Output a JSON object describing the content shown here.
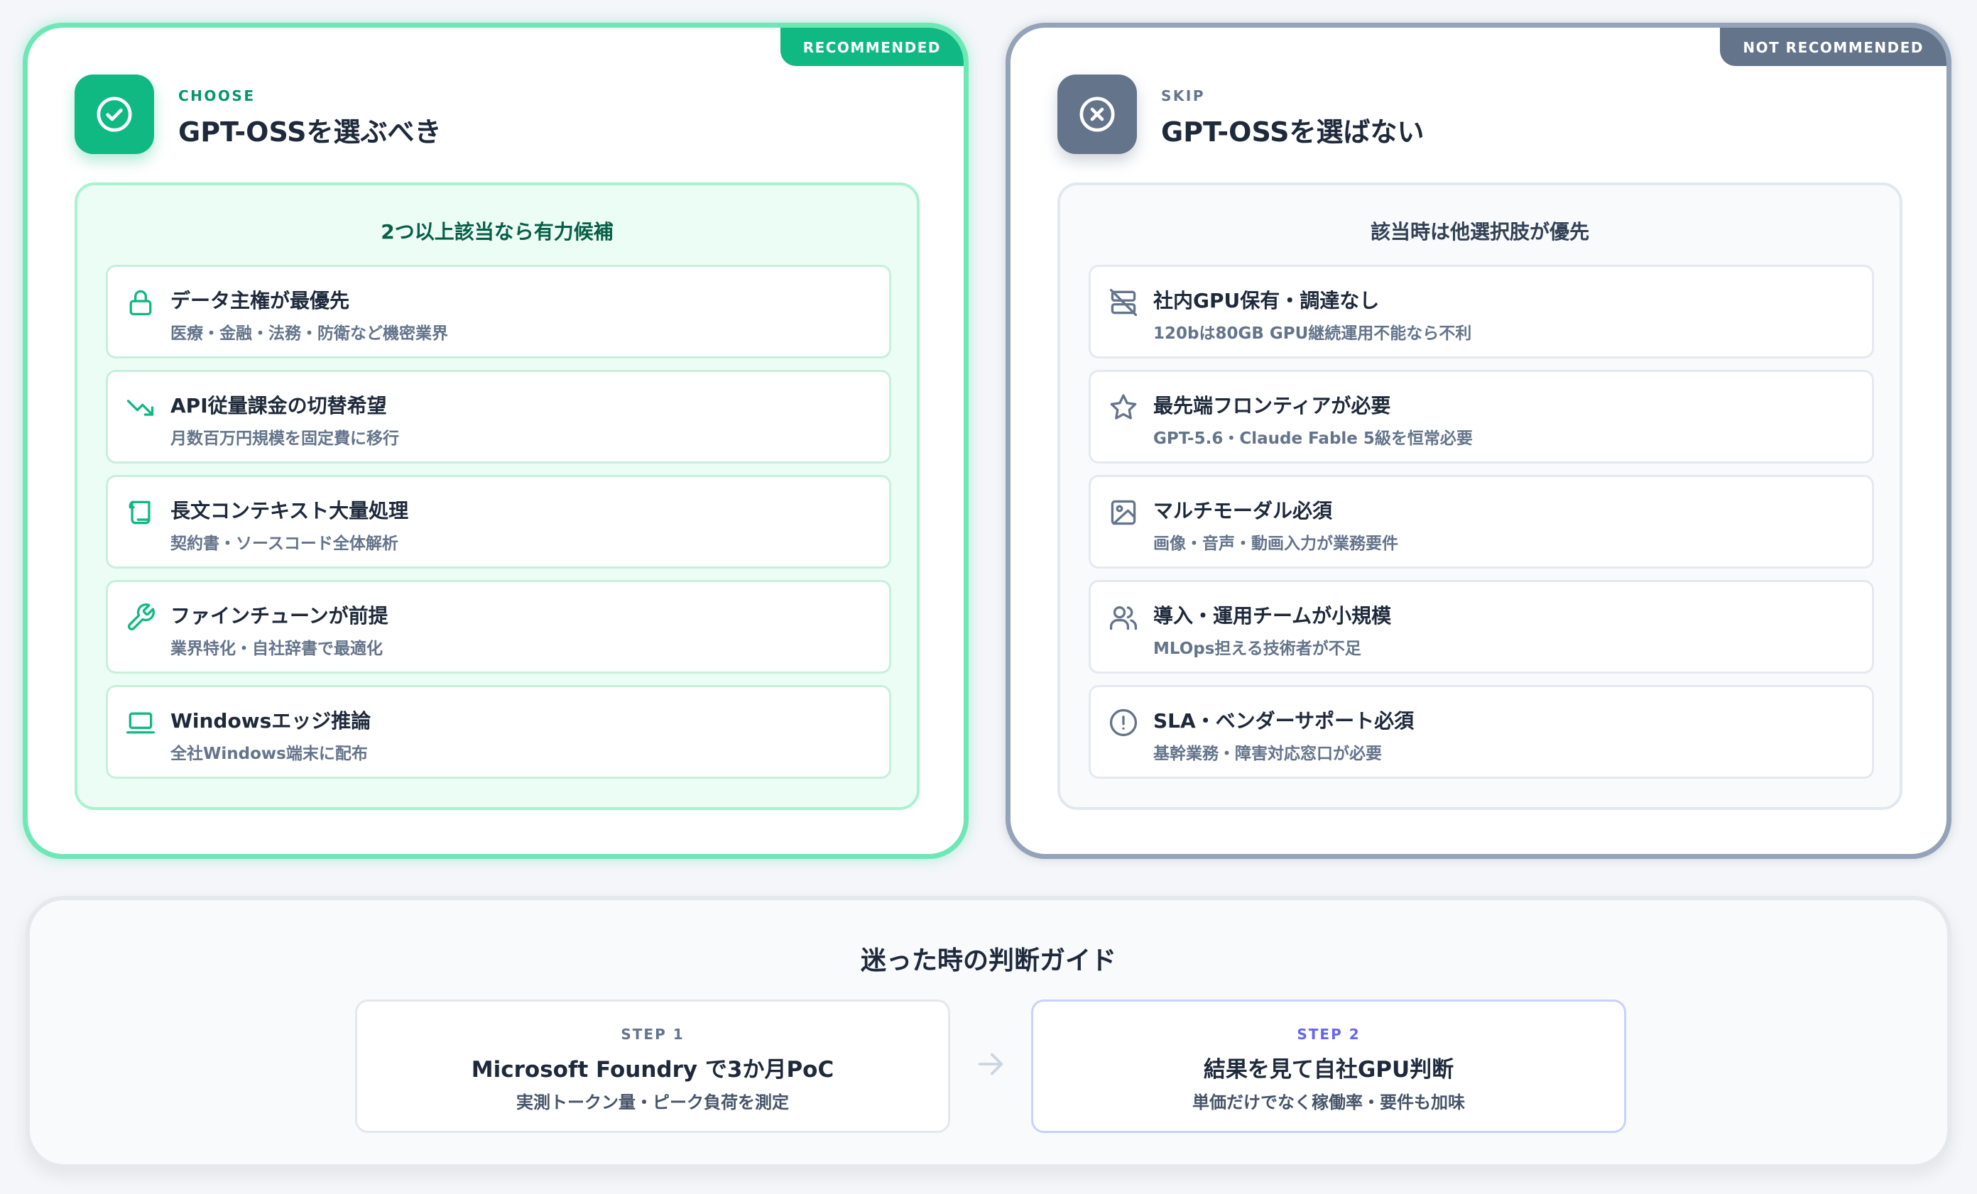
{
  "colors": {
    "choose_accent": "#10b981",
    "skip_accent": "#64748b",
    "step2_accent": "#6366f1"
  },
  "choose_card": {
    "ribbon": "RECOMMENDED",
    "icon": "check-circle-icon",
    "eyebrow": "CHOOSE",
    "title": "GPT-OSSを選ぶべき",
    "panel_heading": "2つ以上該当なら有力候補",
    "items": [
      {
        "icon": "lock-icon",
        "title": "データ主権が最優先",
        "subtitle": "医療・金融・法務・防衛など機密業界"
      },
      {
        "icon": "trending-down-icon",
        "title": "API従量課金の切替希望",
        "subtitle": "月数百万円規模を固定費に移行"
      },
      {
        "icon": "scroll-icon",
        "title": "長文コンテキスト大量処理",
        "subtitle": "契約書・ソースコード全体解析"
      },
      {
        "icon": "wrench-icon",
        "title": "ファインチューンが前提",
        "subtitle": "業界特化・自社辞書で最適化"
      },
      {
        "icon": "laptop-icon",
        "title": "Windowsエッジ推論",
        "subtitle": "全社Windows端末に配布"
      }
    ]
  },
  "skip_card": {
    "ribbon": "NOT RECOMMENDED",
    "icon": "x-circle-icon",
    "eyebrow": "SKIP",
    "title": "GPT-OSSを選ばない",
    "panel_heading": "該当時は他選択肢が優先",
    "items": [
      {
        "icon": "server-off-icon",
        "title": "社内GPU保有・調達なし",
        "subtitle": "120bは80GB GPU継続運用不能なら不利"
      },
      {
        "icon": "star-icon",
        "title": "最先端フロンティアが必要",
        "subtitle": "GPT-5.6・Claude Fable 5級を恒常必要"
      },
      {
        "icon": "image-icon",
        "title": "マルチモーダル必須",
        "subtitle": "画像・音声・動画入力が業務要件"
      },
      {
        "icon": "users-icon",
        "title": "導入・運用チームが小規模",
        "subtitle": "MLOps担える技術者が不足"
      },
      {
        "icon": "alert-circle-icon",
        "title": "SLA・ベンダーサポート必須",
        "subtitle": "基幹業務・障害対応窓口が必要"
      }
    ]
  },
  "guide": {
    "title": "迷った時の判断ガイド",
    "arrow_icon": "arrow-right-icon",
    "steps": [
      {
        "label": "STEP 1",
        "title": "Microsoft Foundry で3か月PoC",
        "subtitle": "実測トークン量・ピーク負荷を測定"
      },
      {
        "label": "STEP 2",
        "title": "結果を見て自社GPU判断",
        "subtitle": "単価だけでなく稼働率・要件も加味"
      }
    ]
  }
}
